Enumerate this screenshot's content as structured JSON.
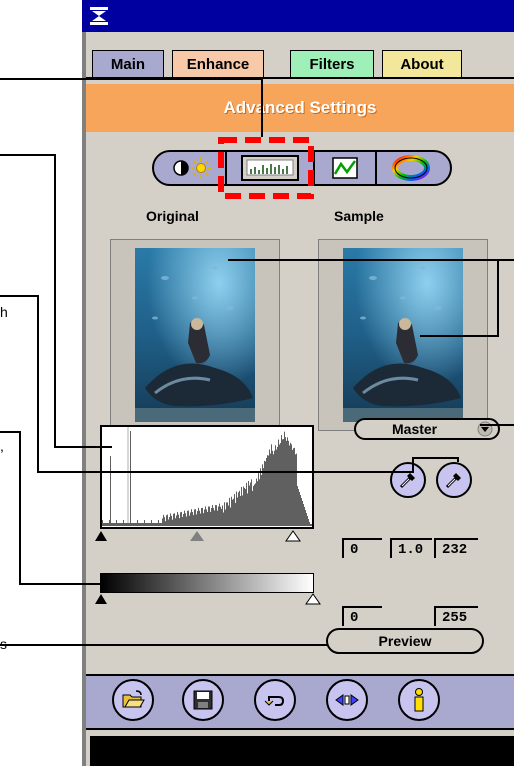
{
  "tabs": [
    {
      "label": "Main",
      "color": "#a9a8cf"
    },
    {
      "label": "Enhance",
      "color": "#f7c9a8"
    },
    {
      "label": "Filters",
      "color": "#9ef0b8"
    },
    {
      "label": "About",
      "color": "#f3e79c"
    }
  ],
  "header": {
    "title": "Advanced Settings",
    "color": "#f7a55b"
  },
  "mode_buttons": [
    "brightness-contrast-icon",
    "histogram-icon",
    "curves-icon",
    "color-wheel-icon"
  ],
  "selected_mode": "histogram-icon",
  "panels": {
    "original_label": "Original",
    "sample_label": "Sample"
  },
  "channel_select": {
    "value": "Master"
  },
  "levels": {
    "black": "0",
    "gamma": "1.0",
    "white": "232"
  },
  "output": {
    "black": "0",
    "white": "255"
  },
  "preview_label": "Preview",
  "callouts": {
    "left_h": "h",
    "left_comma": ",",
    "left_s": "s"
  },
  "bottom_icons": [
    "open-icon",
    "save-icon",
    "undo-icon",
    "compare-icon",
    "info-icon"
  ]
}
